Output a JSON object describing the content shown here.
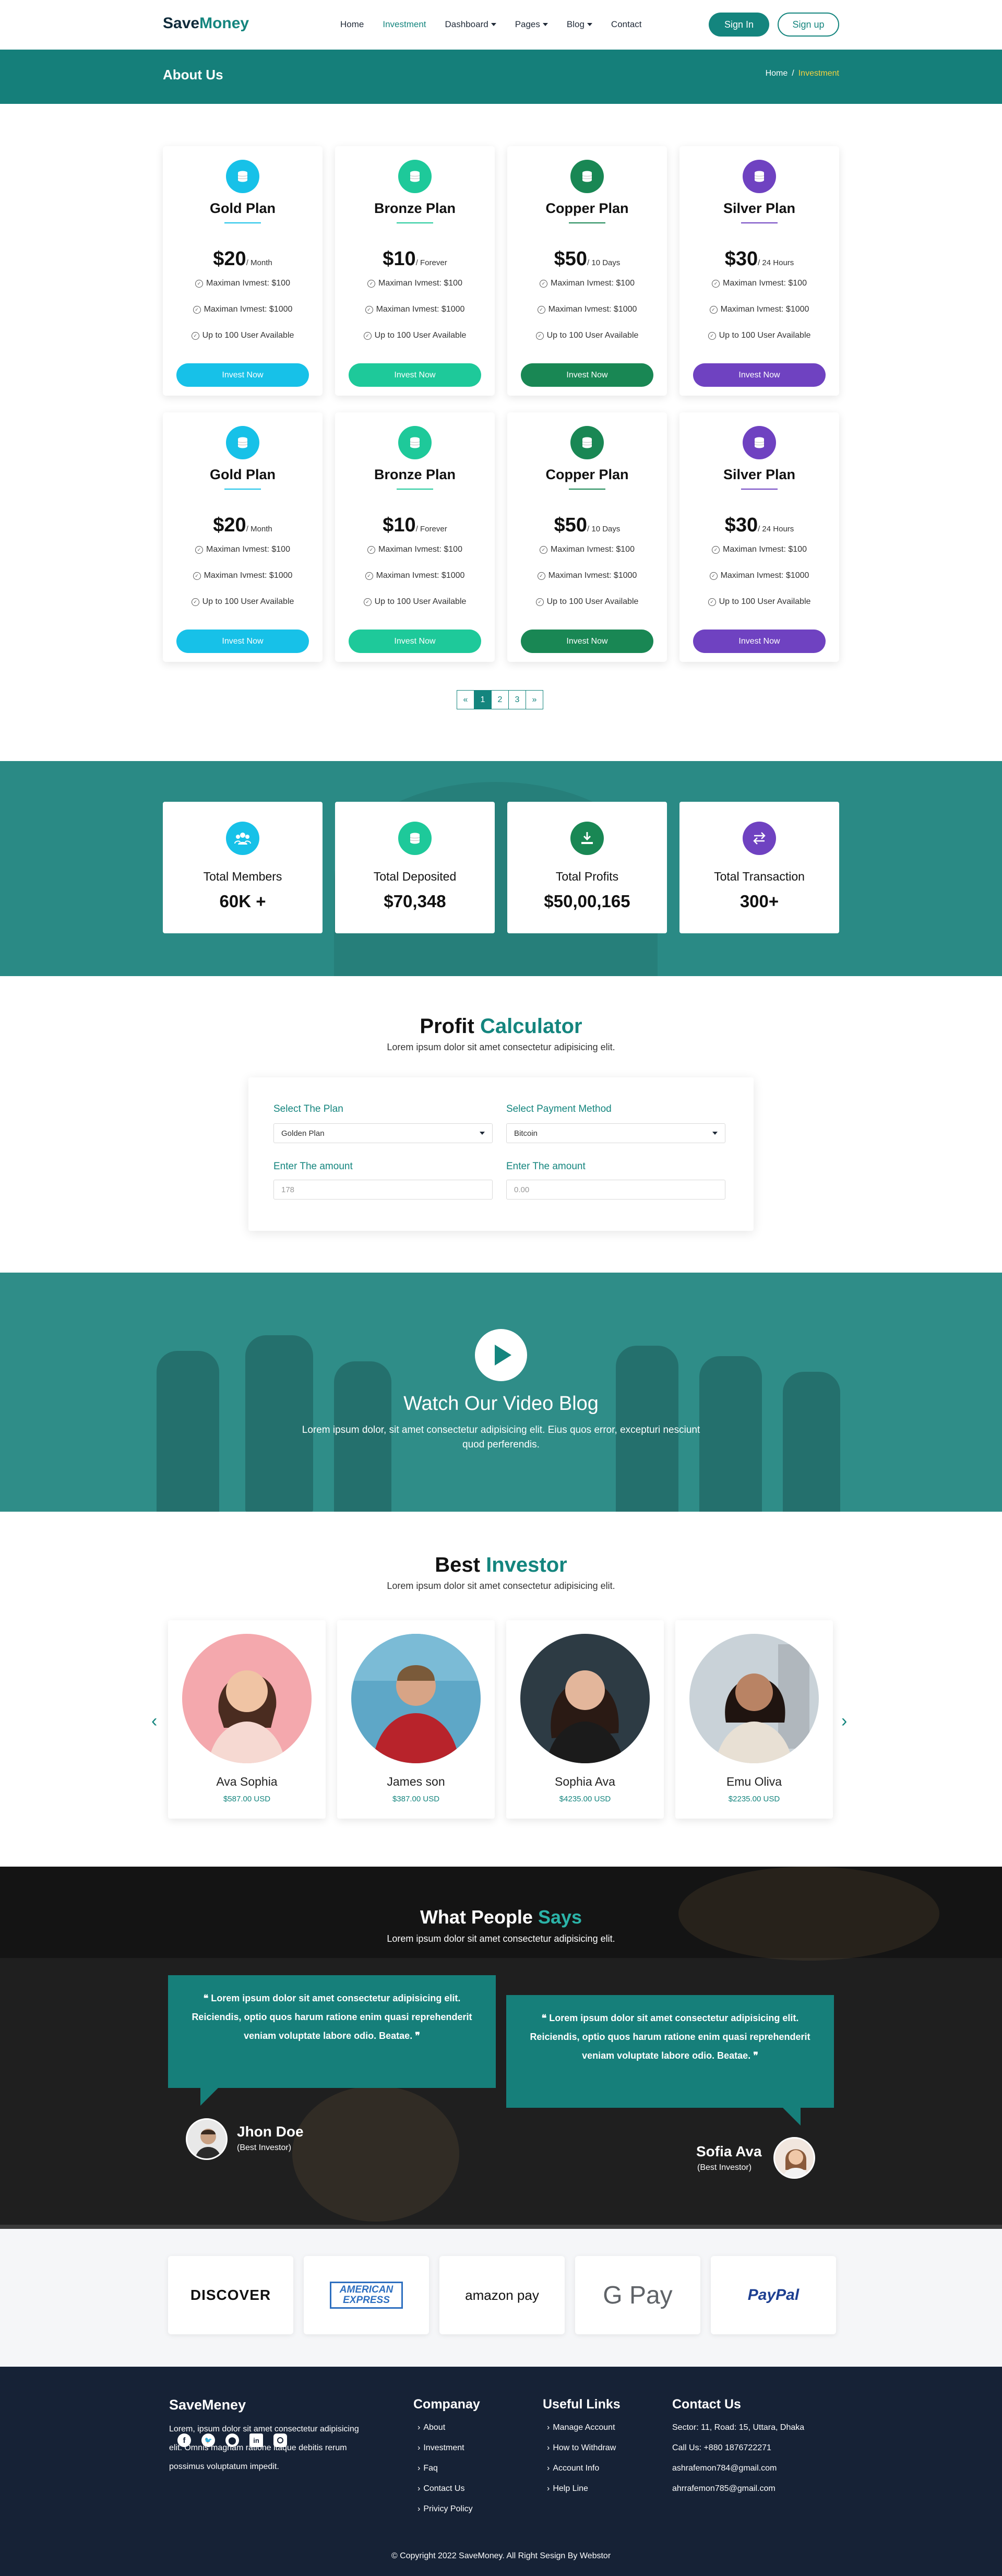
{
  "brand": {
    "logo_a": "Save",
    "logo_b": "Money"
  },
  "nav": [
    {
      "label": "Home"
    },
    {
      "label": "Investment",
      "active": true
    },
    {
      "label": "Dashboard",
      "dropdown": true
    },
    {
      "label": "Pages",
      "dropdown": true
    },
    {
      "label": "Blog",
      "dropdown": true
    },
    {
      "label": "Contact"
    }
  ],
  "auth": {
    "signin": "Sign In",
    "signup": "Sign up"
  },
  "page_title": "About Us",
  "breadcrumb": {
    "home": "Home",
    "sep": "/",
    "current": "Investment"
  },
  "plans": [
    {
      "icon": "coins-icon",
      "color": "#17c1e8",
      "name": "Gold Plan",
      "price": "$20",
      "unit": "/ Month",
      "f1": "Maximan Ivmest: $100",
      "f2": "Maximan Ivmest: $1000",
      "f3": "Up to 100 User Available",
      "button": "Invest Now"
    },
    {
      "icon": "coins-icon",
      "color": "#1ec99a",
      "name": "Bronze Plan",
      "price": "$10",
      "unit": "/ Forever",
      "f1": "Maximan Ivmest: $100",
      "f2": "Maximan Ivmest: $1000",
      "f3": "Up to 100 User Available",
      "button": "Invest Now"
    },
    {
      "icon": "coins-icon",
      "color": "#198754",
      "name": "Copper Plan",
      "price": "$50",
      "unit": "/ 10 Days",
      "f1": "Maximan Ivmest: $100",
      "f2": "Maximan Ivmest: $1000",
      "f3": "Up to 100 User Available",
      "button": "Invest Now"
    },
    {
      "icon": "coins-icon",
      "color": "#6f42c1",
      "name": "Silver Plan",
      "price": "$30",
      "unit": "/ 24 Hours",
      "f1": "Maximan Ivmest: $100",
      "f2": "Maximan Ivmest: $1000",
      "f3": "Up to 100 User Available",
      "button": "Invest Now"
    }
  ],
  "pagination": [
    "«",
    "1",
    "2",
    "3",
    "»"
  ],
  "stats": [
    {
      "icon": "members-icon",
      "color": "#17c1e8",
      "label": "Total Members",
      "value": "60K +"
    },
    {
      "icon": "coins-icon",
      "color": "#1ec99a",
      "label": "Total Deposited",
      "value": "$70,348"
    },
    {
      "icon": "profit-icon",
      "color": "#198754",
      "label": "Total Profits",
      "value": "$50,00,165"
    },
    {
      "icon": "transfer-icon",
      "color": "#6f42c1",
      "label": "Total Transaction",
      "value": "300+"
    }
  ],
  "calc": {
    "title_a": "Profit",
    "title_b": "Calculator",
    "sub": "Lorem ipsum dolor sit amet consectetur adipisicing elit.",
    "plan_label": "Select The Plan",
    "plan_value": "Golden Plan",
    "method_label": "Select Payment Method",
    "method_value": "Bitcoin",
    "amount_label": "Enter The amount",
    "amount_placeholder": "178",
    "amount2_label": "Enter The amount",
    "amount2_placeholder": "0.00"
  },
  "video": {
    "title": "Watch Our Video Blog",
    "sub": "Lorem ipsum dolor, sit amet consectetur adipisicing elit. Eius quos error, excepturi nesciunt quod perferendis."
  },
  "investors": {
    "title_a": "Best",
    "title_b": "Investor",
    "sub": "Lorem ipsum dolor sit amet consectetur adipisicing elit.",
    "prev": "‹",
    "next": "›",
    "items": [
      {
        "name": "Ava Sophia",
        "amount": "$587.00 USD"
      },
      {
        "name": "James son",
        "amount": "$387.00 USD"
      },
      {
        "name": "Sophia Ava",
        "amount": "$4235.00 USD"
      },
      {
        "name": "Emu Oliva",
        "amount": "$2235.00 USD"
      }
    ]
  },
  "testimonials": {
    "title_a": "What People",
    "title_b": "Says",
    "sub": "Lorem ipsum dolor sit amet consectetur adipisicing elit.",
    "items": [
      {
        "text": "❝ Lorem ipsum dolor sit amet consectetur adipisicing elit. Reiciendis, optio quos harum ratione enim quasi reprehenderit veniam voluptate labore odio. Beatae. ❞",
        "name": "Jhon Doe",
        "role": "(Best Investor)"
      },
      {
        "text": "❝ Lorem ipsum dolor sit amet consectetur adipisicing elit. Reiciendis, optio quos harum ratione enim quasi reprehenderit veniam voluptate labore odio. Beatae. ❞",
        "name": "Sofia Ava",
        "role": "(Best Investor)"
      }
    ]
  },
  "payments": [
    "DISCOVER",
    "AMERICAN EXPRESS",
    "amazon pay",
    "G Pay",
    "PayPal"
  ],
  "footer": {
    "brand": "SaveMeney",
    "about": "Lorem, ipsum dolor sit amet consectetur adipisicing elit. Omnis magnam ratione itaque debitis rerum possimus voluptatum impedit.",
    "company_title": "Companay",
    "company": [
      "About",
      "Investment",
      "Faq",
      "Contact Us",
      "Privicy Policy"
    ],
    "links_title": "Useful Links",
    "links": [
      "Manage Account",
      "How to Withdraw",
      "Account Info",
      "Help Line"
    ],
    "contact_title": "Contact Us",
    "contact": [
      "Sector: 11, Road: 15, Uttara, Dhaka",
      "Call Us: +880 1876722271",
      "ashrafemon784@gmail.com",
      "ahrrafemon785@gmail.com"
    ],
    "copyright": "© Copyright 2022 SaveMoney. All Right Sesign By Webstor"
  }
}
